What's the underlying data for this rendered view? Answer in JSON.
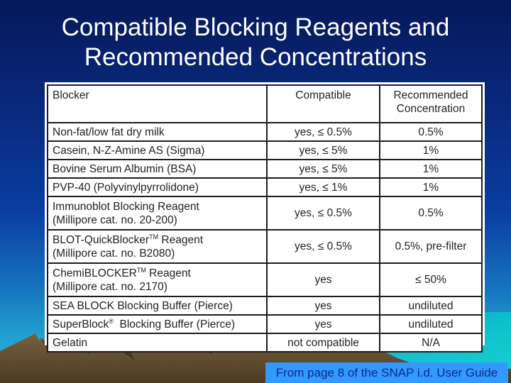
{
  "slide": {
    "title_line1": "Compatible Blocking Reagents and",
    "title_line2": "Recommended Concentrations",
    "caption": "From page 8 of the SNAP i.d. User Guide"
  },
  "table": {
    "headers": {
      "blocker": "Blocker",
      "compatible": "Compatible",
      "recommended_line1": "Recommended",
      "recommended_line2": "Concentration"
    },
    "rows": [
      {
        "blocker": "Non-fat/low fat dry milk",
        "blocker_line2": "",
        "compatible": "yes, ≤ 0.5%",
        "recommended": "0.5%"
      },
      {
        "blocker": "Casein, N-Z-Amine AS (Sigma)",
        "blocker_line2": "",
        "compatible": "yes, ≤ 5%",
        "recommended": "1%"
      },
      {
        "blocker": "Bovine Serum Albumin (BSA)",
        "blocker_line2": "",
        "compatible": "yes, ≤ 5%",
        "recommended": "1%"
      },
      {
        "blocker": "PVP-40 (Polyvinylpyrrolidone)",
        "blocker_line2": "",
        "compatible": "yes, ≤ 1%",
        "recommended": "1%"
      },
      {
        "blocker": "Immunoblot Blocking Reagent",
        "blocker_line2": "(Millipore cat. no. 20-200)",
        "compatible": "yes, ≤ 0.5%",
        "recommended": "0.5%"
      },
      {
        "blocker": "BLOT-QuickBlocker",
        "blocker_mark": "TM",
        "blocker_suffix": " Reagent",
        "blocker_line2": "(Millipore cat. no. B2080)",
        "compatible": "yes, ≤ 0.5%",
        "recommended": "0.5%, pre-filter"
      },
      {
        "blocker": "ChemiBLOCKER",
        "blocker_mark": "TM",
        "blocker_suffix": " Reagent",
        "blocker_line2": "(Millipore cat. no. 2170)",
        "compatible": "yes",
        "recommended": "≤ 50%"
      },
      {
        "blocker": "SEA BLOCK Blocking Buffer (Pierce)",
        "blocker_line2": "",
        "compatible": "yes",
        "recommended": "undiluted"
      },
      {
        "blocker": "SuperBlock",
        "blocker_mark": "®",
        "blocker_suffix": "  Blocking Buffer (Pierce)",
        "blocker_line2": "",
        "compatible": "yes",
        "recommended": "undiluted"
      },
      {
        "blocker": "Gelatin",
        "blocker_line2": "",
        "compatible": "not compatible",
        "recommended": "N/A"
      }
    ]
  },
  "colors": {
    "caption_bg": "#3399ff",
    "caption_text": "#0b2a8a",
    "title_text": "#ffffff",
    "mountain": "#6b5433"
  }
}
